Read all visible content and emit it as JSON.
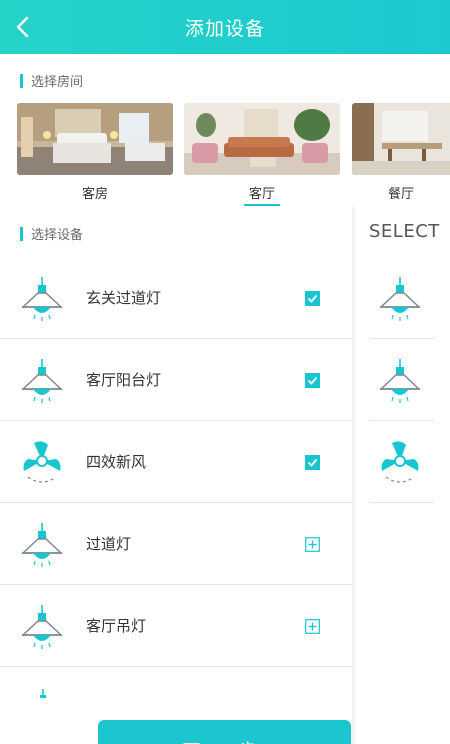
{
  "header": {
    "title": "添加设备"
  },
  "room_section": {
    "label": "选择房间"
  },
  "rooms": [
    {
      "name": "客房",
      "selected": false
    },
    {
      "name": "客厅",
      "selected": true
    },
    {
      "name": "餐厅",
      "selected": false
    }
  ],
  "device_section": {
    "label": "选择设备"
  },
  "devices": [
    {
      "name": "玄关过道灯",
      "icon": "pendant-lamp-icon",
      "state": "checked"
    },
    {
      "name": "客厅阳台灯",
      "icon": "pendant-lamp-icon",
      "state": "checked"
    },
    {
      "name": "四效新风",
      "icon": "fan-icon",
      "state": "checked"
    },
    {
      "name": "过道灯",
      "icon": "pendant-lamp-icon",
      "state": "add"
    },
    {
      "name": "客厅吊灯",
      "icon": "pendant-lamp-icon",
      "state": "add"
    }
  ],
  "right_panel": {
    "title": "SELECT"
  },
  "next_button": {
    "label": "下一步"
  },
  "colors": {
    "accent": "#19c6cf",
    "header_start": "#24d3c8",
    "header_end": "#1bc9cf"
  }
}
